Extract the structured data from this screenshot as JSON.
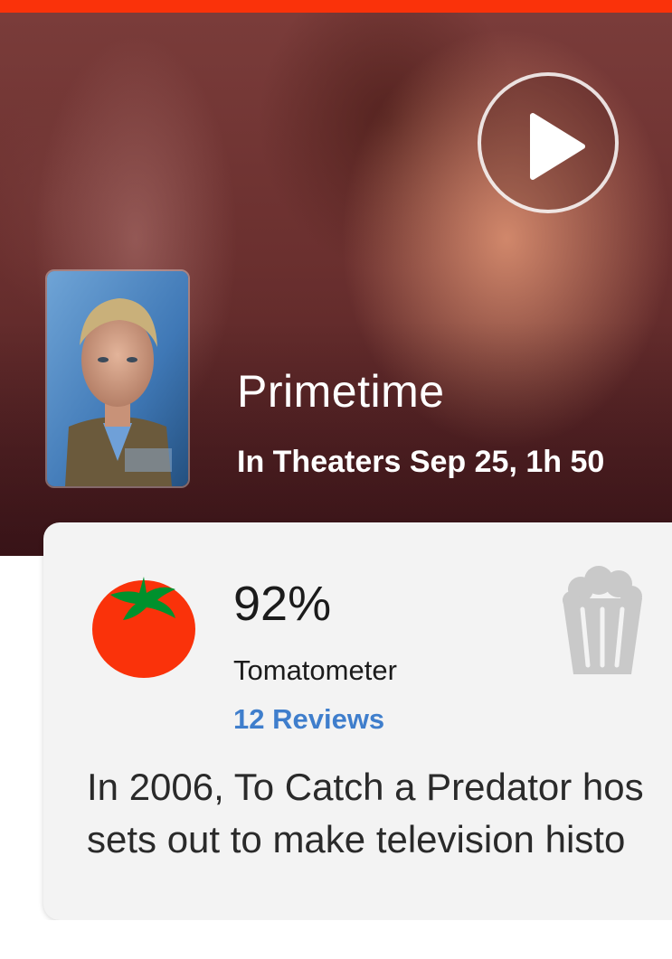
{
  "colors": {
    "brand_red": "#fa320a",
    "link_blue": "#3f7ecc",
    "card_background": "#f3f3f3"
  },
  "hero": {
    "title": "Primetime",
    "release_info": "In Theaters Sep 25, 1h 50",
    "play_icon": "play-circle-icon",
    "poster_icon": "movie-poster"
  },
  "scores": {
    "tomatometer": {
      "icon": "tomato-icon",
      "value": "92%",
      "label": "Tomatometer",
      "reviews": "12 Reviews"
    },
    "audience": {
      "icon": "empty-popcorn-icon"
    }
  },
  "synopsis": {
    "line1": "In 2006, To Catch a Predator hos",
    "line2": "sets out to make television histo"
  }
}
